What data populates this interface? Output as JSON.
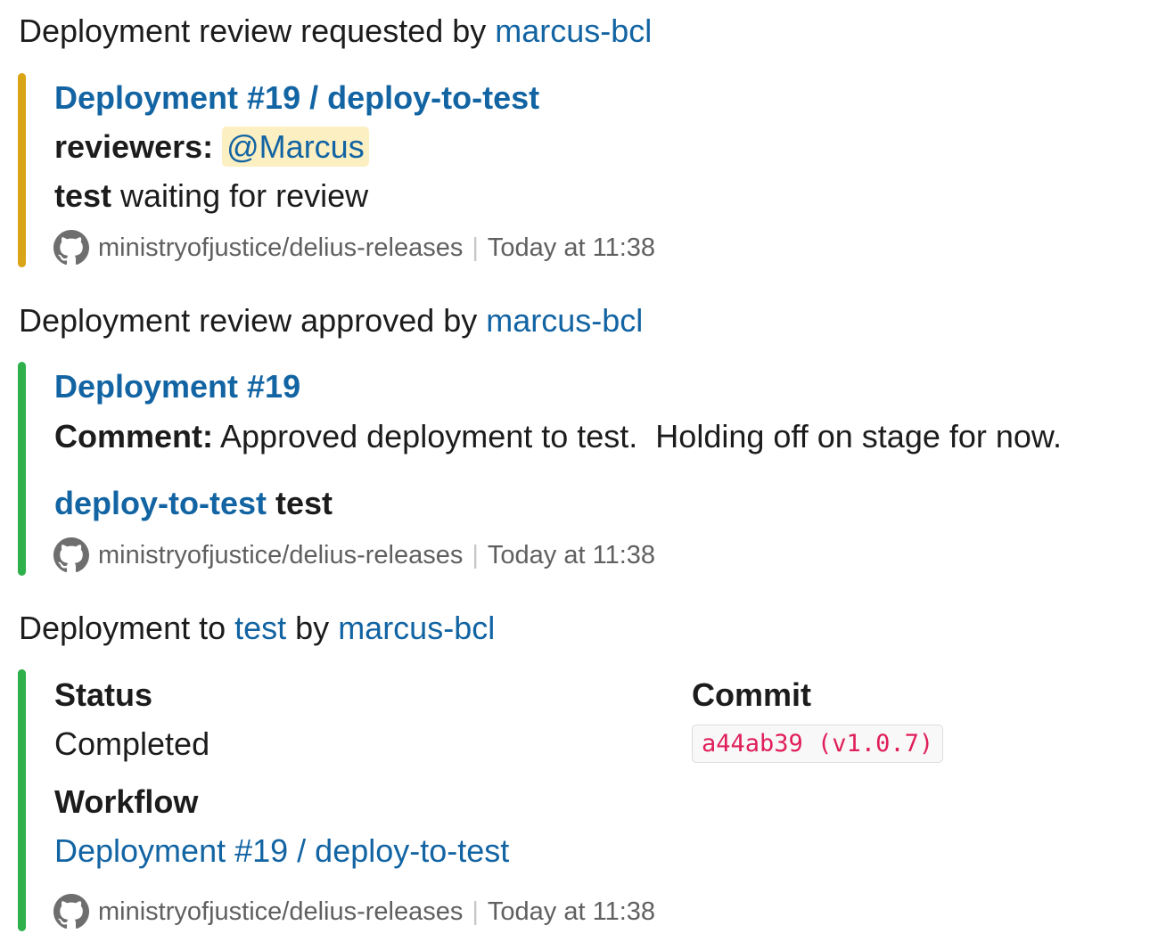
{
  "messages": [
    {
      "pretext": "Deployment review requested by ",
      "pretext_user": "marcus-bcl",
      "bar_color": "#d9a415",
      "title": "Deployment #19 / deploy-to-test",
      "reviewers_label": "reviewers:",
      "reviewer_mention": "@Marcus",
      "env_bold": "test",
      "env_text": " waiting for review",
      "footer": {
        "repo": "ministryofjustice/delius-releases",
        "separator": "|",
        "time": "Today at 11:38"
      }
    },
    {
      "pretext": "Deployment review approved by ",
      "pretext_user": "marcus-bcl",
      "bar_color": "#2eb04b",
      "title": "Deployment #19",
      "comment_label": "Comment:",
      "comment_text": " Approved deployment to test.  Holding off on stage for now.",
      "deploy_link": "deploy-to-test",
      "deploy_env": " test",
      "footer": {
        "repo": "ministryofjustice/delius-releases",
        "separator": "|",
        "time": "Today at 11:38"
      }
    },
    {
      "pretext": "Deployment to ",
      "pretext_env": "test",
      "pretext_by": " by ",
      "pretext_user": "marcus-bcl",
      "bar_color": "#2eb04b",
      "fields": {
        "status_title": "Status",
        "status_value": "Completed",
        "commit_title": "Commit",
        "commit_value": "a44ab39 (v1.0.7)",
        "workflow_title": "Workflow",
        "workflow_value": "Deployment #19 / deploy-to-test"
      },
      "footer": {
        "repo": "ministryofjustice/delius-releases",
        "separator": "|",
        "time": "Today at 11:38"
      }
    }
  ],
  "icons": {
    "footer_icon": "github-icon"
  }
}
